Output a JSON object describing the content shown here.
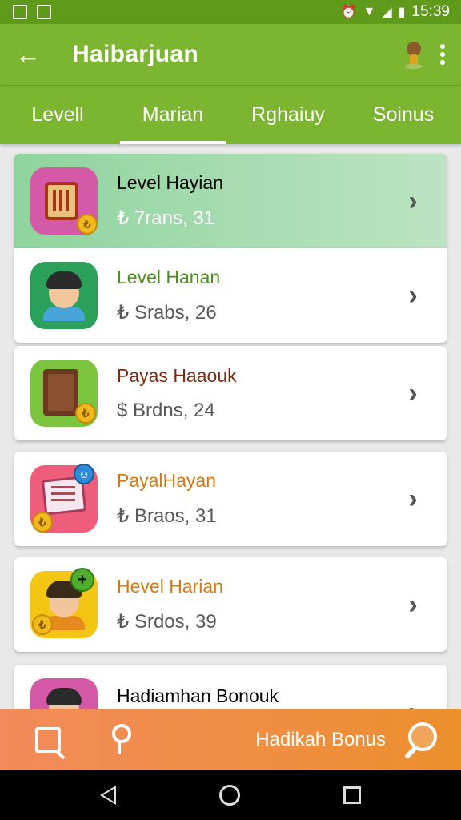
{
  "status_bar": {
    "time": "15:39"
  },
  "app_bar": {
    "back_icon": "arrow-left-icon",
    "title": "Haibarjuan"
  },
  "tabs": [
    {
      "label": "Levell",
      "active": false
    },
    {
      "label": "Marian",
      "active": true
    },
    {
      "label": "Rghaiuy",
      "active": false
    },
    {
      "label": "Soinus",
      "active": false
    }
  ],
  "items": [
    {
      "title": "Level Hayian",
      "subtitle": "₺ 7rans, 31",
      "title_color": "#1f1f1f",
      "icon": "game-box-icon"
    },
    {
      "title": "Level Hanan",
      "subtitle": "₺ Srabs, 26",
      "title_color": "#4f8f1e",
      "icon": "man-avatar-icon"
    },
    {
      "title": "Payas Haaouk",
      "subtitle": "$ Brdns, 24",
      "title_color": "#7a2c12",
      "icon": "book-icon"
    },
    {
      "title": "PayalHayan",
      "subtitle": "₺ Braos, 31",
      "title_color": "#d47a14",
      "icon": "notes-icon"
    },
    {
      "title": "Hevel Harian",
      "subtitle": "₺ Srdos, 39",
      "title_color": "#d47a14",
      "icon": "man-plus-icon"
    },
    {
      "title": "Hadiamhan Bonouk",
      "subtitle": "",
      "title_color": "#1f1f1f",
      "icon": "man-avatar-icon"
    }
  ],
  "bottom_bar": {
    "label": "Hadikah Bonus"
  }
}
